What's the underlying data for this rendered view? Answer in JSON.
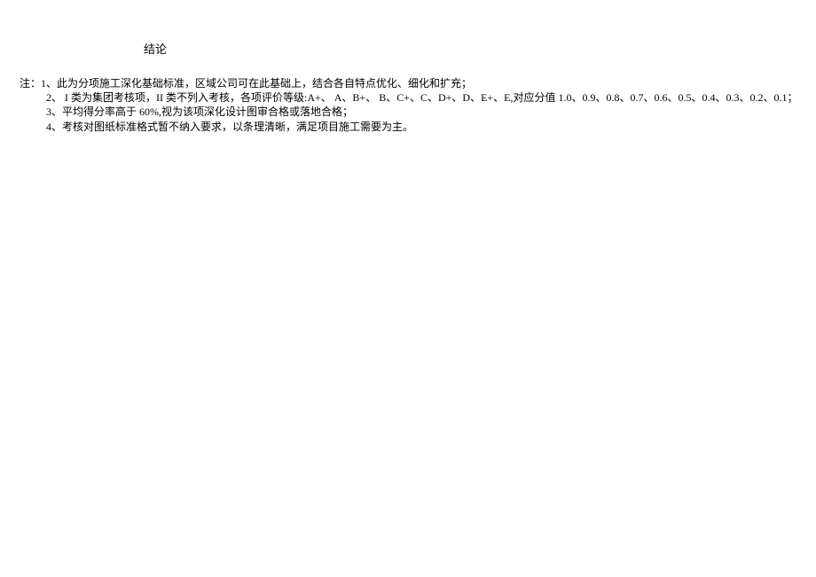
{
  "title": "结论",
  "notes": {
    "prefix": "注：",
    "items": [
      "1、此为分项施工深化基础标准，区域公司可在此基础上，结合各自特点优化、细化和扩充；",
      "2、  I 类为集团考核项，II 类不列入考核，各项评价等级:A+、 A、B+、 B、C+、C、D+、D、E+、E,对应分值 1.0、0.9、0.8、0.7、0.6、0.5、0.4、0.3、0.2、0.1；",
      "3、平均得分率高于 60%,视为该项深化设计图审合格或落地合格；",
      "4、考核对图纸标准格式暂不纳入要求，以条理清晰，满足项目施工需要为主。"
    ]
  }
}
